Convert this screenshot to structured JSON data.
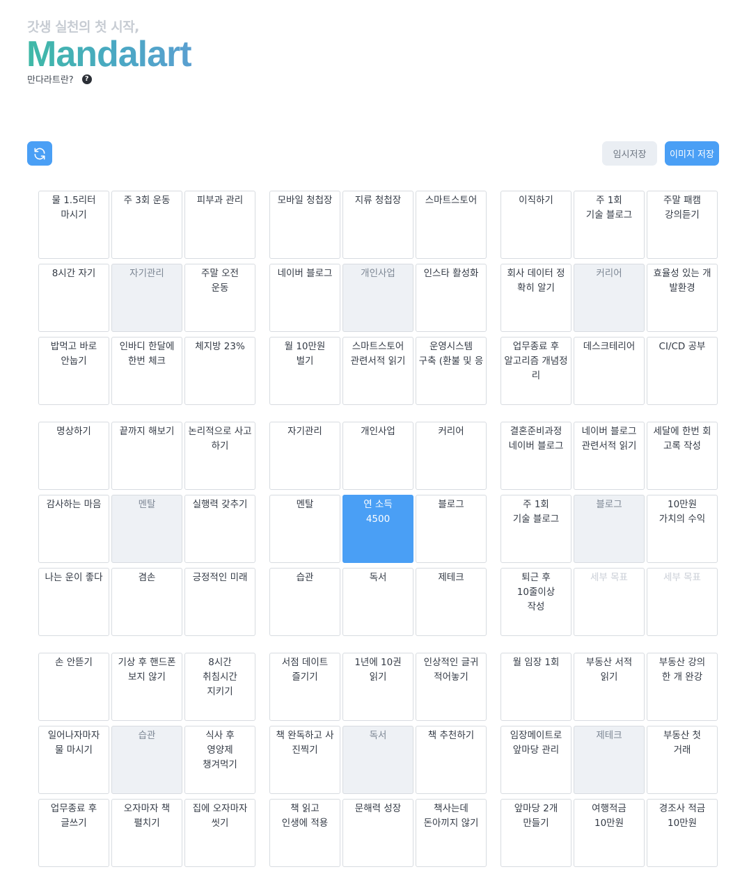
{
  "header": {
    "tagline": "갓생 실천의 첫 시작,",
    "logo": "Mandalart",
    "what_is": "만다라트란?",
    "help_icon": "question-circle-icon"
  },
  "toolbar": {
    "refresh_icon": "refresh-icon",
    "temp_save_label": "임시저장",
    "image_save_label": "이미지 저장"
  },
  "colors": {
    "accent": "#4a9ff5",
    "sub_goal_bg": "#eef1f5",
    "logo_gradient": [
      "#3fb9a6",
      "#5a9fd0"
    ]
  },
  "mandalart": {
    "blocks": [
      {
        "id": "자기관리",
        "cells": [
          {
            "text": "물 1.5리터\n마시기",
            "kind": "normal"
          },
          {
            "text": "주 3회 운동",
            "kind": "normal"
          },
          {
            "text": "피부과 관리",
            "kind": "normal"
          },
          {
            "text": "8시간 자기",
            "kind": "normal"
          },
          {
            "text": "자기관리",
            "kind": "sub"
          },
          {
            "text": "주말 오전\n운동",
            "kind": "normal"
          },
          {
            "text": "밥먹고 바로\n안눕기",
            "kind": "normal"
          },
          {
            "text": "인바디 한달에 한번 체크",
            "kind": "normal"
          },
          {
            "text": "체지방 23%",
            "kind": "normal"
          }
        ]
      },
      {
        "id": "개인사업",
        "cells": [
          {
            "text": "모바일 청첩장",
            "kind": "normal"
          },
          {
            "text": "지류 청첩장",
            "kind": "normal"
          },
          {
            "text": "스마트스토어",
            "kind": "normal"
          },
          {
            "text": "네이버 블로그",
            "kind": "normal"
          },
          {
            "text": "개인사업",
            "kind": "sub"
          },
          {
            "text": "인스타 활성화",
            "kind": "normal"
          },
          {
            "text": "월 10만원\n벌기",
            "kind": "normal"
          },
          {
            "text": "스마트스토어\n관련서적 읽기",
            "kind": "normal"
          },
          {
            "text": "운영시스템\n구축 (환불 및 응",
            "kind": "normal"
          }
        ]
      },
      {
        "id": "커리어",
        "cells": [
          {
            "text": "이직하기",
            "kind": "normal"
          },
          {
            "text": "주 1회\n기술 블로그",
            "kind": "normal"
          },
          {
            "text": "주말 패캠\n강의듣기",
            "kind": "normal"
          },
          {
            "text": "회사 데이터 정확히 알기",
            "kind": "normal"
          },
          {
            "text": "커리어",
            "kind": "sub"
          },
          {
            "text": "효율성 있는 개발환경",
            "kind": "normal"
          },
          {
            "text": "업무종료 후\n알고리즘 개념정리",
            "kind": "normal"
          },
          {
            "text": "데스크테리어",
            "kind": "normal"
          },
          {
            "text": "CI/CD 공부",
            "kind": "normal"
          }
        ]
      },
      {
        "id": "멘탈",
        "cells": [
          {
            "text": "명상하기",
            "kind": "normal"
          },
          {
            "text": "끝까지 해보기",
            "kind": "normal"
          },
          {
            "text": "논리적으로 사고하기",
            "kind": "normal"
          },
          {
            "text": "감사하는 마음",
            "kind": "normal"
          },
          {
            "text": "멘탈",
            "kind": "sub"
          },
          {
            "text": "실행력 갖추기",
            "kind": "normal"
          },
          {
            "text": "나는 운이 좋다",
            "kind": "normal"
          },
          {
            "text": "겸손",
            "kind": "normal"
          },
          {
            "text": "긍정적인 미래",
            "kind": "normal"
          }
        ]
      },
      {
        "id": "center",
        "cells": [
          {
            "text": "자기관리",
            "kind": "normal"
          },
          {
            "text": "개인사업",
            "kind": "normal"
          },
          {
            "text": "커리어",
            "kind": "normal"
          },
          {
            "text": "멘탈",
            "kind": "normal"
          },
          {
            "text": "연 소득\n4500",
            "kind": "main"
          },
          {
            "text": "블로그",
            "kind": "normal"
          },
          {
            "text": "습관",
            "kind": "normal"
          },
          {
            "text": "독서",
            "kind": "normal"
          },
          {
            "text": "제테크",
            "kind": "normal"
          }
        ]
      },
      {
        "id": "블로그",
        "cells": [
          {
            "text": "결혼준비과정\n네이버 블로그",
            "kind": "normal"
          },
          {
            "text": "네이버 블로그 관련서적 읽기",
            "kind": "normal"
          },
          {
            "text": "세달에 한번 회고록 작성",
            "kind": "normal"
          },
          {
            "text": "주 1회\n기술 블로그",
            "kind": "normal"
          },
          {
            "text": "블로그",
            "kind": "sub"
          },
          {
            "text": "10만원\n가치의 수익",
            "kind": "normal"
          },
          {
            "text": "퇴근 후\n10줄이상\n작성",
            "kind": "normal"
          },
          {
            "text": "세부 목표",
            "kind": "placeholder"
          },
          {
            "text": "세부 목표",
            "kind": "placeholder"
          }
        ]
      },
      {
        "id": "습관",
        "cells": [
          {
            "text": "손 안뜯기",
            "kind": "normal"
          },
          {
            "text": "기상 후 핸드폰 보지 않기",
            "kind": "normal"
          },
          {
            "text": "8시간\n취침시간\n지키기",
            "kind": "normal"
          },
          {
            "text": "일어나자마자\n물 마시기",
            "kind": "normal"
          },
          {
            "text": "습관",
            "kind": "sub"
          },
          {
            "text": "식사 후\n영양제\n챙겨먹기",
            "kind": "normal"
          },
          {
            "text": "업무종료 후\n글쓰기",
            "kind": "normal"
          },
          {
            "text": "오자마자 책\n펼치기",
            "kind": "normal"
          },
          {
            "text": "집에 오자마자\n씻기",
            "kind": "normal"
          }
        ]
      },
      {
        "id": "독서",
        "cells": [
          {
            "text": "서점 데이트\n즐기기",
            "kind": "normal"
          },
          {
            "text": "1년에 10권\n읽기",
            "kind": "normal"
          },
          {
            "text": "인상적인 글귀\n적어놓기",
            "kind": "normal"
          },
          {
            "text": "책 완독하고 사진찍기",
            "kind": "normal"
          },
          {
            "text": "독서",
            "kind": "sub"
          },
          {
            "text": "책 추천하기",
            "kind": "normal"
          },
          {
            "text": "책 읽고\n인생에 적용",
            "kind": "normal"
          },
          {
            "text": "문해력 성장",
            "kind": "normal"
          },
          {
            "text": "책사는데\n돈아끼지 않기",
            "kind": "normal"
          }
        ]
      },
      {
        "id": "제테크",
        "cells": [
          {
            "text": "월 임장 1회",
            "kind": "normal"
          },
          {
            "text": "부동산 서적\n읽기",
            "kind": "normal"
          },
          {
            "text": "부동산 강의\n한 개 완강",
            "kind": "normal"
          },
          {
            "text": "임장메이트로\n앞마당 관리",
            "kind": "normal"
          },
          {
            "text": "제테크",
            "kind": "sub"
          },
          {
            "text": "부동산 첫\n거래",
            "kind": "normal"
          },
          {
            "text": "앞마당 2개\n만들기",
            "kind": "normal"
          },
          {
            "text": "여행적금\n10만원",
            "kind": "normal"
          },
          {
            "text": "경조사 적금\n10만원",
            "kind": "normal"
          }
        ]
      }
    ]
  }
}
